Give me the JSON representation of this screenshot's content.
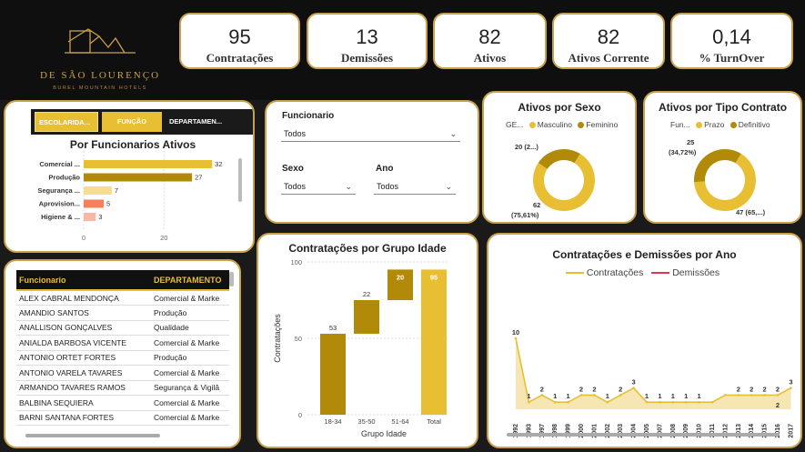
{
  "brand": {
    "line1": "DE SÃO LOURENÇO",
    "line2": "BUREL MOUNTAIN HOTELS"
  },
  "kpis": [
    {
      "value": "95",
      "label": "Contratações"
    },
    {
      "value": "13",
      "label": "Demissões"
    },
    {
      "value": "82",
      "label": "Ativos"
    },
    {
      "value": "82",
      "label": "Ativos Corrente"
    },
    {
      "value": "0,14",
      "label": "% TurnOver"
    }
  ],
  "func_chart": {
    "tabs": [
      "ESCOLARIDA...",
      "FUNÇÃO",
      "DEPARTAMEN..."
    ],
    "title": "Por Funcionarios Ativos",
    "colors": [
      "#e8bf33",
      "#b08a08",
      "#f5dc8e",
      "#f4805c",
      "#f7b8a8"
    ]
  },
  "filters": {
    "funcionario_label": "Funcionario",
    "funcionario_value": "Todos",
    "sexo_label": "Sexo",
    "sexo_value": "Todos",
    "ano_label": "Ano",
    "ano_value": "Todos"
  },
  "sexo_chart": {
    "title": "Ativos por Sexo",
    "legend_title": "GE...",
    "small_label": "20 (2...)",
    "big_label": "62",
    "big_pct": "(75,61%)"
  },
  "contrato_chart": {
    "title": "Ativos por Tipo Contrato",
    "legend_title": "Fun...",
    "small_label": "25",
    "small_pct": "(34,72%)",
    "big_label": "47 (65,...)"
  },
  "table": {
    "headers": [
      "Funcionario",
      "DEPARTAMENTO"
    ],
    "rows": [
      [
        "ALEX CABRAL MENDONÇA",
        "Comercial & Marke"
      ],
      [
        "AMANDIO SANTOS",
        "Produção"
      ],
      [
        "ANALLISON GONÇALVES",
        "Qualidade"
      ],
      [
        "ANIALDA BARBOSA VICENTE",
        "Comercial & Marke"
      ],
      [
        "ANTONIO ORTET FORTES",
        "Produção"
      ],
      [
        "ANTONIO VARELA TAVARES",
        "Comercial & Marke"
      ],
      [
        "ARMANDO TAVARES RAMOS",
        "Segurança & Vigilâ"
      ],
      [
        "BALBINA SEQUIERA",
        "Comercial & Marke"
      ],
      [
        "BARNI SANTANA FORTES",
        "Comercial & Marke"
      ]
    ]
  },
  "chart_data": [
    {
      "type": "bar",
      "title": "Por Funcionarios Ativos",
      "orientation": "horizontal",
      "categories": [
        "Comercial ...",
        "Produção",
        "Segurança ...",
        "Aprovision...",
        "Higiene & ..."
      ],
      "values": [
        32,
        27,
        7,
        5,
        3
      ],
      "xticks": [
        "0",
        "20"
      ],
      "xlim": [
        0,
        34
      ]
    },
    {
      "type": "pie",
      "title": "Ativos por Sexo",
      "legend_title": "GE...",
      "categories": [
        "Masculino",
        "Feminino"
      ],
      "values": [
        62,
        20
      ],
      "colors": [
        "#e8bf33",
        "#b08a08"
      ]
    },
    {
      "type": "pie",
      "title": "Ativos por Tipo Contrato",
      "legend_title": "Fun...",
      "categories": [
        "Prazo",
        "Definitivo"
      ],
      "values": [
        47,
        25
      ],
      "colors": [
        "#e8bf33",
        "#b08a08"
      ]
    },
    {
      "type": "bar",
      "subtype": "waterfall",
      "title": "Contratações por Grupo Idade",
      "xlabel": "Grupo Idade",
      "ylabel": "Contratações",
      "categories": [
        "18-34",
        "35-50",
        "51-64",
        "Total"
      ],
      "values": [
        53,
        22,
        20,
        95
      ],
      "ylim": [
        0,
        100
      ],
      "yticks": [
        "0",
        "50",
        "100"
      ],
      "colors": {
        "step": "#b08a08",
        "total": "#e8bf33"
      }
    },
    {
      "type": "line",
      "title": "Contratações e Demissões por Ano",
      "x": [
        "1992",
        "1993",
        "1997",
        "1998",
        "1999",
        "2000",
        "2001",
        "2002",
        "2003",
        "2004",
        "2005",
        "2007",
        "2008",
        "2009",
        "2010",
        "2011",
        "2012",
        "2013",
        "2014",
        "2015",
        "2016",
        "2017"
      ],
      "series": [
        {
          "name": "Contratações",
          "values": [
            10,
            1,
            2,
            1,
            1,
            2,
            2,
            1,
            2,
            3,
            1,
            1,
            1,
            1,
            1,
            1,
            2,
            2,
            2,
            2,
            2,
            3
          ],
          "color": "#e8bf33"
        },
        {
          "name": "Demissões",
          "values": [],
          "color": "#e0334f"
        }
      ],
      "point_labels": [
        "10",
        "1",
        "2",
        "1",
        "1",
        "2",
        "2",
        "1",
        "2",
        "3",
        "1",
        "1",
        "1",
        "1",
        "1",
        "2",
        "2",
        "2",
        "2",
        "3"
      ],
      "secondary_label": "2"
    }
  ]
}
